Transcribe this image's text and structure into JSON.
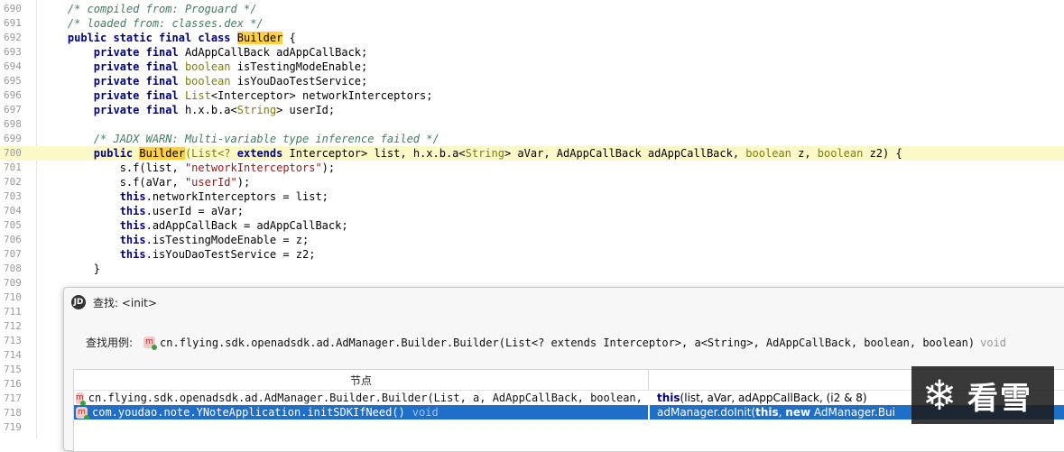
{
  "code_lines": [
    {
      "n": "690",
      "code": [
        {
          "t": "    "
        },
        {
          "t": "/* compiled from: Proguard */",
          "c": "cm"
        }
      ]
    },
    {
      "n": "691",
      "code": [
        {
          "t": "    "
        },
        {
          "t": "/* loaded from: classes.dex */",
          "c": "cm"
        }
      ]
    },
    {
      "n": "692",
      "code": [
        {
          "t": "    "
        },
        {
          "t": "public static final class ",
          "c": "kw"
        },
        {
          "t": "Builder",
          "c": "mark"
        },
        {
          "t": " {"
        }
      ]
    },
    {
      "n": "693",
      "code": [
        {
          "t": "        "
        },
        {
          "t": "private final ",
          "c": "kw"
        },
        {
          "t": "AdAppCallBack adAppCallBack;"
        }
      ]
    },
    {
      "n": "694",
      "code": [
        {
          "t": "        "
        },
        {
          "t": "private final ",
          "c": "kw"
        },
        {
          "t": "boolean",
          "c": "ty"
        },
        {
          "t": " isTestingModeEnable;"
        }
      ]
    },
    {
      "n": "695",
      "code": [
        {
          "t": "        "
        },
        {
          "t": "private final ",
          "c": "kw"
        },
        {
          "t": "boolean",
          "c": "ty"
        },
        {
          "t": " isYouDaoTestService;"
        }
      ]
    },
    {
      "n": "696",
      "code": [
        {
          "t": "        "
        },
        {
          "t": "private final ",
          "c": "kw"
        },
        {
          "t": "List",
          "c": "ty"
        },
        {
          "t": "<Interceptor> networkInterceptors;"
        }
      ]
    },
    {
      "n": "697",
      "code": [
        {
          "t": "        "
        },
        {
          "t": "private final ",
          "c": "kw"
        },
        {
          "t": "h.x.b.a<"
        },
        {
          "t": "String",
          "c": "ty"
        },
        {
          "t": "> userId;"
        }
      ]
    },
    {
      "n": "698",
      "code": [
        {
          "t": ""
        }
      ]
    },
    {
      "n": "699",
      "code": [
        {
          "t": "        "
        },
        {
          "t": "/* JADX WARN: Multi-variable type inference failed */",
          "c": "cm"
        }
      ]
    },
    {
      "n": "700",
      "hl": true,
      "code": [
        {
          "t": "        "
        },
        {
          "t": "public ",
          "c": "kw"
        },
        {
          "t": "Builder",
          "c": "mark"
        },
        {
          "t": "(List<? ",
          "c": "ty"
        },
        {
          "t": "extends ",
          "c": "kw"
        },
        {
          "t": "Interceptor> list, h.x.b.a<"
        },
        {
          "t": "String",
          "c": "ty"
        },
        {
          "t": "> aVar, AdAppCallBack adAppCallBack, "
        },
        {
          "t": "boolean",
          "c": "ty"
        },
        {
          "t": " z, "
        },
        {
          "t": "boolean",
          "c": "ty"
        },
        {
          "t": " z2) {"
        }
      ]
    },
    {
      "n": "701",
      "code": [
        {
          "t": "            s.f(list, "
        },
        {
          "t": "\"networkInterceptors\"",
          "c": "st"
        },
        {
          "t": ");"
        }
      ]
    },
    {
      "n": "702",
      "code": [
        {
          "t": "            s.f(aVar, "
        },
        {
          "t": "\"userId\"",
          "c": "st"
        },
        {
          "t": ");"
        }
      ]
    },
    {
      "n": "703",
      "code": [
        {
          "t": "            "
        },
        {
          "t": "this",
          "c": "kw"
        },
        {
          "t": ".networkInterceptors = list;"
        }
      ]
    },
    {
      "n": "704",
      "code": [
        {
          "t": "            "
        },
        {
          "t": "this",
          "c": "kw"
        },
        {
          "t": ".userId = aVar;"
        }
      ]
    },
    {
      "n": "705",
      "code": [
        {
          "t": "            "
        },
        {
          "t": "this",
          "c": "kw"
        },
        {
          "t": ".adAppCallBack = adAppCallBack;"
        }
      ]
    },
    {
      "n": "706",
      "code": [
        {
          "t": "            "
        },
        {
          "t": "this",
          "c": "kw"
        },
        {
          "t": ".isTestingModeEnable = z;"
        }
      ]
    },
    {
      "n": "707",
      "code": [
        {
          "t": "            "
        },
        {
          "t": "this",
          "c": "kw"
        },
        {
          "t": ".isYouDaoTestService = z2;"
        }
      ]
    },
    {
      "n": "708",
      "code": [
        {
          "t": "        }"
        }
      ]
    },
    {
      "n": "709",
      "code": [
        {
          "t": ""
        }
      ]
    },
    {
      "n": "710",
      "code": [
        {
          "t": ""
        }
      ]
    },
    {
      "n": "711",
      "code": [
        {
          "t": ""
        }
      ]
    },
    {
      "n": "712",
      "code": [
        {
          "t": ""
        }
      ]
    },
    {
      "n": "713",
      "code": [
        {
          "t": ""
        }
      ]
    },
    {
      "n": "714",
      "code": [
        {
          "t": ""
        }
      ]
    },
    {
      "n": "715",
      "code": [
        {
          "t": ""
        }
      ]
    },
    {
      "n": "716",
      "code": [
        {
          "t": ""
        }
      ]
    },
    {
      "n": "717",
      "code": [
        {
          "t": ""
        }
      ]
    },
    {
      "n": "718",
      "code": [
        {
          "t": ""
        }
      ]
    },
    {
      "n": "719",
      "code": [
        {
          "t": ""
        }
      ]
    }
  ],
  "popup": {
    "logo_icon": "jadx-logo-icon",
    "logo_text": "JD",
    "title": "查找: <init>",
    "find_label": "查找用例:",
    "method_icon": "m",
    "method_signature": "cn.flying.sdk.openadsdk.ad.AdManager.Builder.Builder(List<? extends Interceptor>, a<String>, AdAppCallBack, boolean, boolean)",
    "method_return": "void",
    "table": {
      "col_node": "节点",
      "rows": [
        {
          "icon": "m",
          "node": "cn.flying.sdk.openadsdk.ad.AdManager.Builder.Builder(List, a, AdAppCallBack, boolean, bo",
          "ret": "",
          "code_kw": "this",
          "code": "(list, aVar, adAppCallBack, (i2 & 8) ",
          "selected": false
        },
        {
          "icon": "m",
          "node": "com.youdao.note.YNoteApplication.initSDKIfNeed()",
          "ret": "void",
          "code_pre": "adManager.doInit(",
          "code_kw": "this",
          "code_mid": ", ",
          "code_kw2": "new",
          "code": " AdManager.Bui",
          "selected": true
        }
      ]
    }
  },
  "watermark": {
    "text": "看雪",
    "icon": "snowflake-icon",
    "glyph": "❄"
  }
}
